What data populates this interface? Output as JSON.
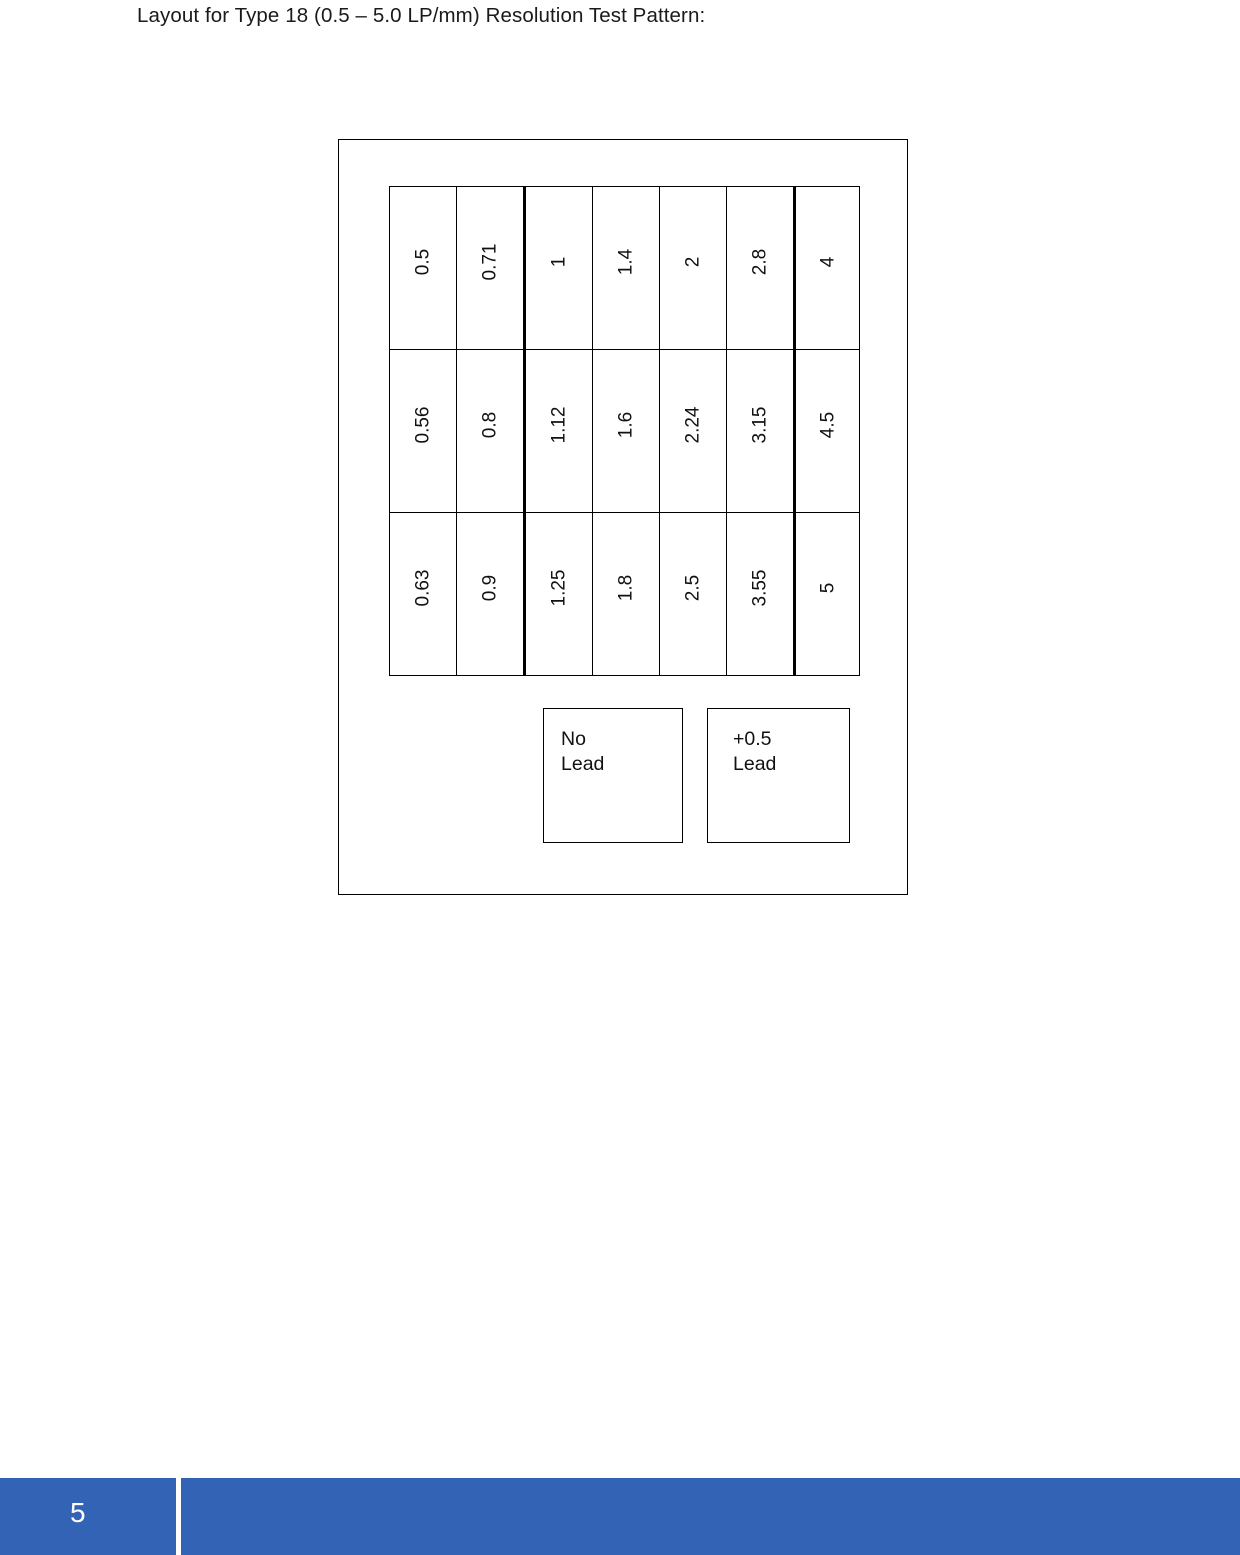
{
  "document": {
    "title": "Layout for Type 18 (0.5 – 5.0 LP/mm) Resolution Test Pattern:"
  },
  "figure": {
    "grid": {
      "rows": [
        [
          "0.5",
          "0.71",
          "1",
          "1.4",
          "2",
          "2.8",
          "4"
        ],
        [
          "0.56",
          "0.8",
          "1.12",
          "1.6",
          "2.24",
          "3.15",
          "4.5"
        ],
        [
          "0.63",
          "0.9",
          "1.25",
          "1.8",
          "2.5",
          "3.55",
          "5"
        ]
      ]
    },
    "legend": {
      "no_lead": "No\nLead",
      "plus_lead": "+0.5\nLead"
    }
  },
  "footer": {
    "page_number": "5",
    "bar_color": "#3363b4"
  }
}
